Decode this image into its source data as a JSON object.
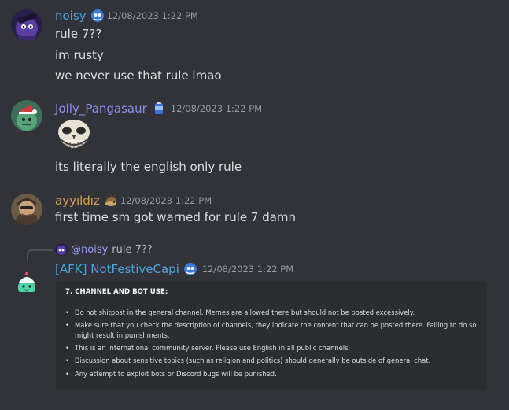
{
  "messages": [
    {
      "username": "noisy",
      "username_color": "#4aa3df",
      "badge": "blue-ghost-icon",
      "timestamp": "12/08/2023 1:22 PM",
      "lines": [
        "rule 7??",
        "im rusty",
        "we never use that rule lmao"
      ]
    },
    {
      "username": "Jolly_Pangasaur",
      "username_color": "#8c8ef5",
      "badge": "blue-can-icon",
      "timestamp": "12/08/2023 1:22 PM",
      "emoji": "troll-skull-emoji",
      "lines": [
        "its literally the english only rule"
      ]
    },
    {
      "username": "ayyıldız",
      "username_color": "#d4a154",
      "badge": "hedgehog-icon",
      "timestamp": "12/08/2023 1:22 PM",
      "lines": [
        "first time sm got warned for rule 7 damn"
      ]
    },
    {
      "username": "[AFK] NotFestiveCapi",
      "username_color": "#4aa3df",
      "badge": "blue-ghost-icon",
      "timestamp": "12/08/2023 1:22 PM",
      "reply": {
        "name": "@noisy",
        "text": "rule 7??"
      },
      "embed": {
        "title": "7. CHANNEL AND BOT USE:",
        "items": [
          "Do not shitpost in the general channel. Memes are allowed there but should not be posted excessively.",
          "Make sure that you check the description of channels, they indicate the content that can be posted there. Failing to do so might result in punishments.",
          "This is an international community server. Please use English in all public channels.",
          "Discussion about sensitive topics (such as religion and politics) should generally be outside of general chat.",
          "Any attempt to exploit bots or Discord bugs will be punished."
        ]
      }
    }
  ]
}
